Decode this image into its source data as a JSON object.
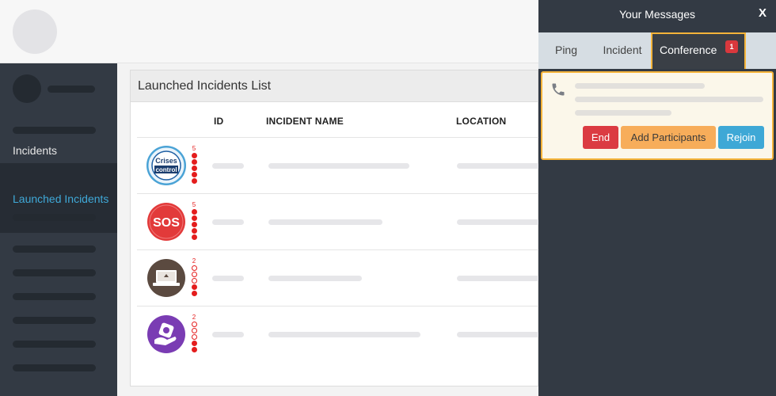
{
  "drawer": {
    "title": "Your Messages",
    "close": "X",
    "tabs": [
      {
        "label": "Ping"
      },
      {
        "label": "Incident"
      },
      {
        "label": "Conference",
        "badge": "1"
      }
    ],
    "card": {
      "icon": "phone-icon",
      "buttons": {
        "end": "End",
        "add": "Add Participants",
        "rejoin": "Rejoin"
      }
    }
  },
  "sidebar": {
    "items": [
      {
        "label": "Incidents"
      },
      {
        "label": "Launched Incidents"
      }
    ]
  },
  "main": {
    "title": "Launched Incidents List",
    "columns": [
      "ID",
      "INCIDENT NAME",
      "LOCATION"
    ],
    "rows": [
      {
        "icon": "crises-control-icon",
        "icon_text": [
          "Crises",
          "control"
        ],
        "level": "5"
      },
      {
        "icon": "sos-icon",
        "icon_text": [
          "SOS"
        ],
        "level": "5"
      },
      {
        "icon": "laptop-icon",
        "level": "2"
      },
      {
        "icon": "hand-shield-icon",
        "level": "2"
      }
    ]
  },
  "colors": {
    "sidebar": "#333a44",
    "active_link": "#3fa9d8",
    "accent_border": "#f5b43a",
    "level_dot": "#e41d1d"
  }
}
